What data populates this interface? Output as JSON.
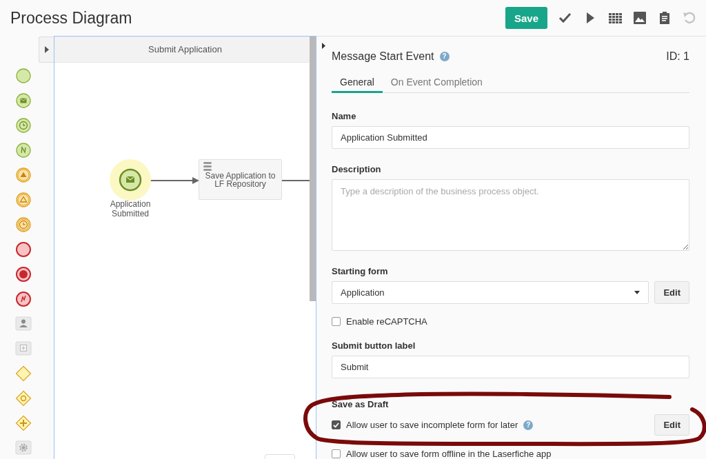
{
  "header": {
    "title": "Process Diagram",
    "save": "Save"
  },
  "toolbar": [
    {
      "kind": "check",
      "disabled": false
    },
    {
      "kind": "play",
      "disabled": false
    },
    {
      "kind": "grid",
      "disabled": false
    },
    {
      "kind": "image",
      "disabled": false
    },
    {
      "kind": "clipboard",
      "disabled": false
    },
    {
      "kind": "undo",
      "disabled": true
    }
  ],
  "palette": [
    {
      "kind": "start"
    },
    {
      "kind": "start-message"
    },
    {
      "kind": "start-timer"
    },
    {
      "kind": "start-signal"
    },
    {
      "kind": "intermediate-escalation"
    },
    {
      "kind": "intermediate-escalation-outline"
    },
    {
      "kind": "intermediate-timer"
    },
    {
      "kind": "end"
    },
    {
      "kind": "end-terminate"
    },
    {
      "kind": "end-error"
    },
    {
      "kind": "user-task"
    },
    {
      "kind": "subprocess"
    },
    {
      "kind": "gateway-exclusive"
    },
    {
      "kind": "gateway-event"
    },
    {
      "kind": "gateway-parallel"
    },
    {
      "kind": "service-task"
    }
  ],
  "lane": {
    "title": "Submit Application"
  },
  "diagram": {
    "nodes": [
      {
        "kind": "message-start",
        "label": "Application Submitted",
        "selected": true
      },
      {
        "kind": "service-task",
        "label": "Save Application to LF Repository",
        "selected": false
      }
    ]
  },
  "panel": {
    "title": "Message Start Event",
    "help": "?",
    "id": "ID: 1",
    "tabs": [
      {
        "label": "General",
        "selected": true
      },
      {
        "label": "On Event Completion",
        "selected": false
      }
    ],
    "fields": [
      {
        "kind": "text",
        "label": "Name",
        "value": "Application Submitted"
      },
      {
        "kind": "textarea",
        "label": "Description",
        "placeholder": "Type a description of the business process object."
      },
      {
        "kind": "select",
        "label": "Starting form",
        "value": "Application",
        "button": "Edit"
      },
      {
        "kind": "checkbox",
        "text": "Enable reCAPTCHA",
        "checked": false
      },
      {
        "kind": "text",
        "label": "Submit button label",
        "value": "Submit"
      },
      {
        "kind": "heading",
        "label": "Save as Draft"
      },
      {
        "kind": "checkbox",
        "text": "Allow user to save incomplete form for later",
        "checked": true,
        "help": "?",
        "button": "Edit"
      },
      {
        "kind": "checkbox",
        "text": "Allow user to save form offline in the Laserfiche app",
        "checked": false
      }
    ]
  }
}
